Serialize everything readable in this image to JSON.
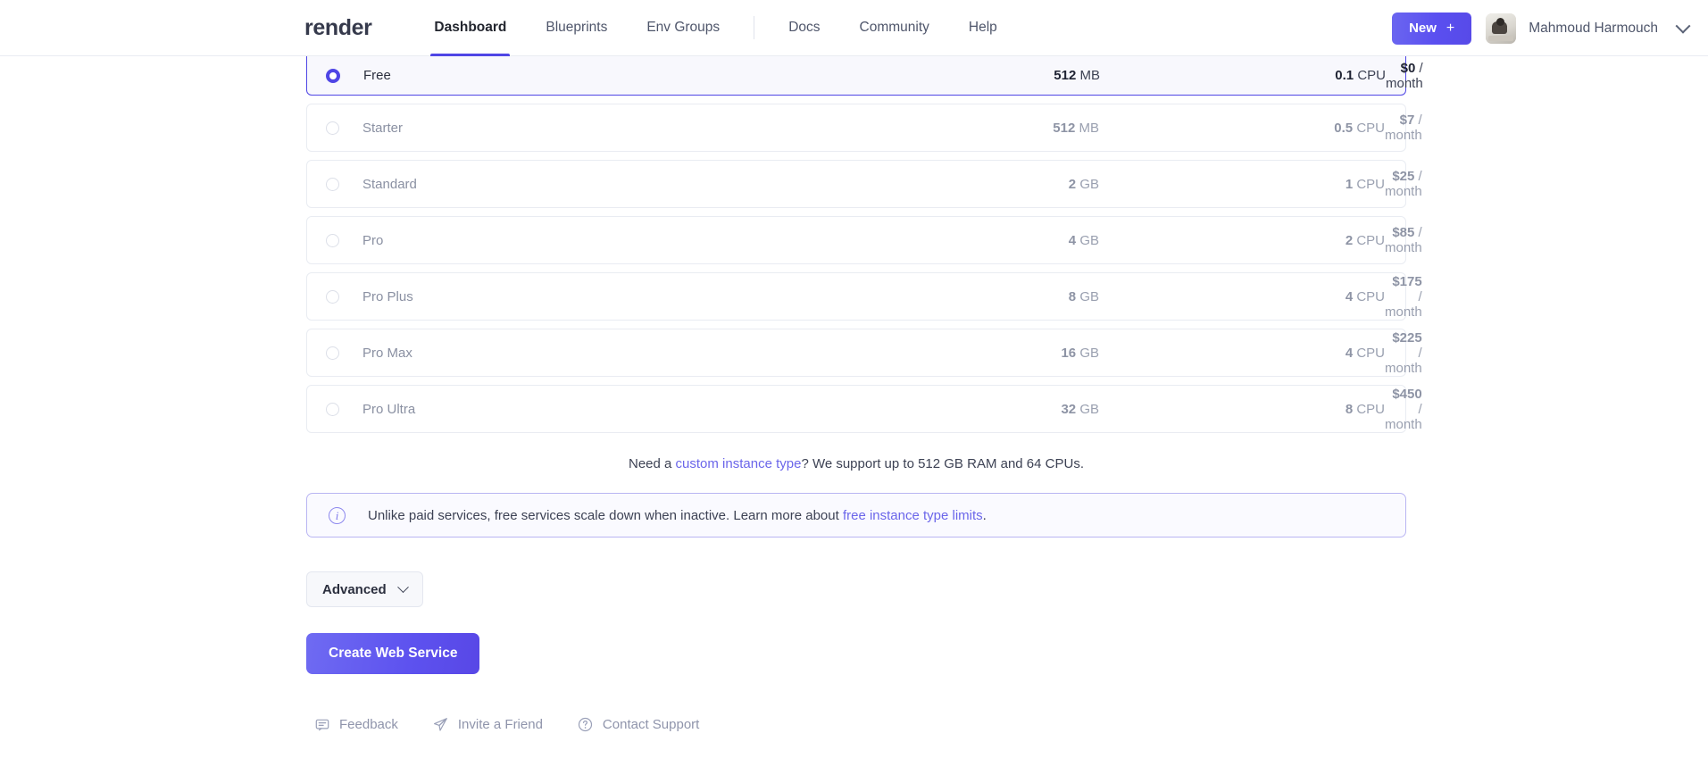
{
  "header": {
    "brand": "render",
    "nav_primary": [
      {
        "label": "Dashboard",
        "active": true
      },
      {
        "label": "Blueprints",
        "active": false
      },
      {
        "label": "Env Groups",
        "active": false
      }
    ],
    "nav_secondary": [
      {
        "label": "Docs"
      },
      {
        "label": "Community"
      },
      {
        "label": "Help"
      }
    ],
    "new_button": "New",
    "new_button_plus": "+",
    "user_name": "Mahmoud Harmouch",
    "accent_color": "#4f46e5"
  },
  "plans": {
    "rows": [
      {
        "name": "Free",
        "mem_value": "512",
        "mem_unit": "MB",
        "cpu_value": "0.1",
        "cpu_unit": "CPU",
        "price_value": "$0",
        "price_unit": "/ month",
        "selected": true
      },
      {
        "name": "Starter",
        "mem_value": "512",
        "mem_unit": "MB",
        "cpu_value": "0.5",
        "cpu_unit": "CPU",
        "price_value": "$7",
        "price_unit": "/ month",
        "selected": false
      },
      {
        "name": "Standard",
        "mem_value": "2",
        "mem_unit": "GB",
        "cpu_value": "1",
        "cpu_unit": "CPU",
        "price_value": "$25",
        "price_unit": "/ month",
        "selected": false
      },
      {
        "name": "Pro",
        "mem_value": "4",
        "mem_unit": "GB",
        "cpu_value": "2",
        "cpu_unit": "CPU",
        "price_value": "$85",
        "price_unit": "/ month",
        "selected": false
      },
      {
        "name": "Pro Plus",
        "mem_value": "8",
        "mem_unit": "GB",
        "cpu_value": "4",
        "cpu_unit": "CPU",
        "price_value": "$175",
        "price_unit": "/ month",
        "selected": false
      },
      {
        "name": "Pro Max",
        "mem_value": "16",
        "mem_unit": "GB",
        "cpu_value": "4",
        "cpu_unit": "CPU",
        "price_value": "$225",
        "price_unit": "/ month",
        "selected": false
      },
      {
        "name": "Pro Ultra",
        "mem_value": "32",
        "mem_unit": "GB",
        "cpu_value": "8",
        "cpu_unit": "CPU",
        "price_value": "$450",
        "price_unit": "/ month",
        "selected": false
      }
    ]
  },
  "custom_note": {
    "prefix": "Need a ",
    "link": "custom instance type",
    "suffix": "? We support up to 512 GB RAM and 64 CPUs."
  },
  "banner": {
    "icon": "info-icon",
    "prefix": "Unlike paid services, free services scale down when inactive. Learn more about ",
    "link": "free instance type limits",
    "suffix": "."
  },
  "advanced": {
    "label": "Advanced"
  },
  "create": {
    "label": "Create Web Service"
  },
  "footer": {
    "links": [
      {
        "label": "Feedback",
        "icon": "feedback-icon"
      },
      {
        "label": "Invite a Friend",
        "icon": "paper-plane-icon"
      },
      {
        "label": "Contact Support",
        "icon": "question-circle-icon"
      }
    ]
  }
}
